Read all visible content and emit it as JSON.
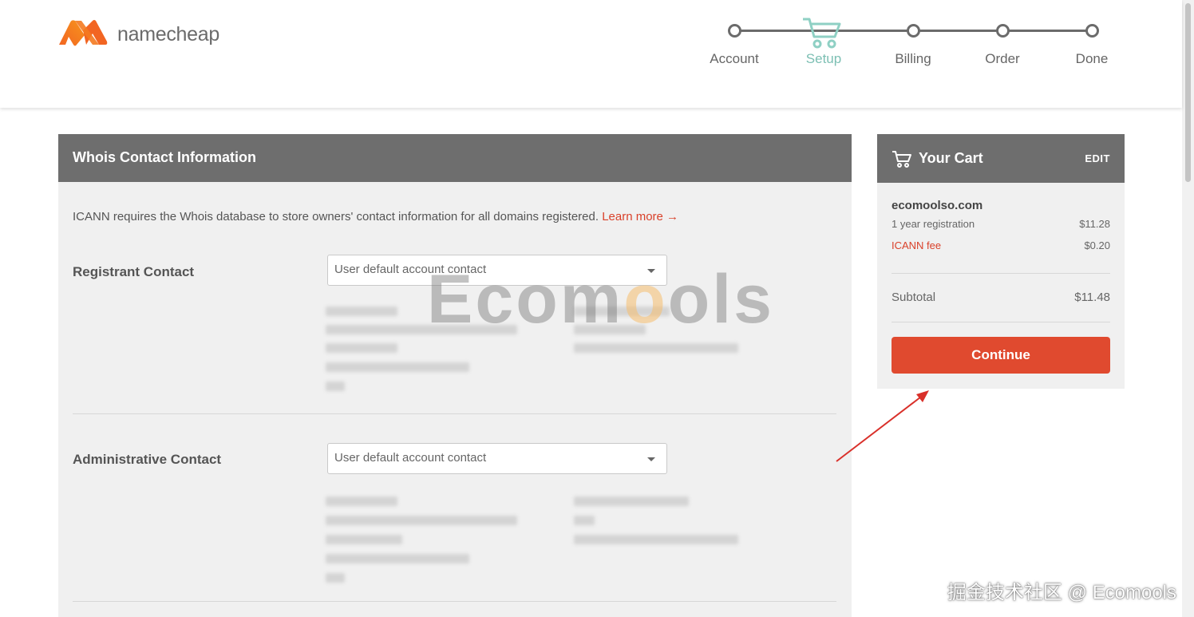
{
  "brand": {
    "name": "namecheap",
    "accent": "#e04a2f",
    "logo_color": "#f46a22"
  },
  "steps": [
    {
      "label": "Account",
      "state": "done"
    },
    {
      "label": "Setup",
      "state": "active"
    },
    {
      "label": "Billing",
      "state": "pending"
    },
    {
      "label": "Order",
      "state": "pending"
    },
    {
      "label": "Done",
      "state": "pending"
    }
  ],
  "whois": {
    "title": "Whois Contact Information",
    "intro": "ICANN requires the Whois database to store owners' contact information for all domains registered.",
    "learn_more": "Learn more →",
    "contacts": [
      {
        "label": "Registrant Contact",
        "selected": "User default account contact"
      },
      {
        "label": "Administrative Contact",
        "selected": "User default account contact"
      }
    ]
  },
  "cart": {
    "title": "Your Cart",
    "edit": "EDIT",
    "domain": "ecomoolso.com",
    "items": [
      {
        "name": "1 year registration",
        "price": "$11.28"
      },
      {
        "name": "ICANN fee",
        "price": "$0.20"
      }
    ],
    "subtotal_label": "Subtotal",
    "subtotal": "$11.48",
    "continue": "Continue"
  },
  "watermark": {
    "text": "Ecomools",
    "footer": "掘金技术社区 @ Ecomools"
  },
  "colors": {
    "header_bar": "#6e6e6e",
    "active_step": "#7cbfb3",
    "link": "#d9412a",
    "annotation_arrow": "#d9302a"
  }
}
